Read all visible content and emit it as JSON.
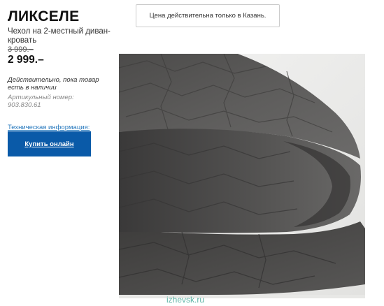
{
  "product": {
    "title": "ЛИКСЕЛЕ",
    "description": "Чехол на 2-местный диван-кровать",
    "old_price": "3 999.–",
    "new_price": "2 999.–",
    "availability": "Действительно, пока товар есть в наличии",
    "article": "Артикульный номер: 903.830.61",
    "tech_info_link": "Техническая информация:",
    "buy_button": "Купить онлайн"
  },
  "notice": {
    "price_note": "Цена действительна только в Казань."
  },
  "image": {
    "icon": "folded-quilted-cover-photo",
    "fabric_color": "#5a5958",
    "watermark": "izhevsk.ru"
  },
  "colors": {
    "buy_button_bg": "#0a5aa8",
    "link": "#2a7bbf"
  }
}
